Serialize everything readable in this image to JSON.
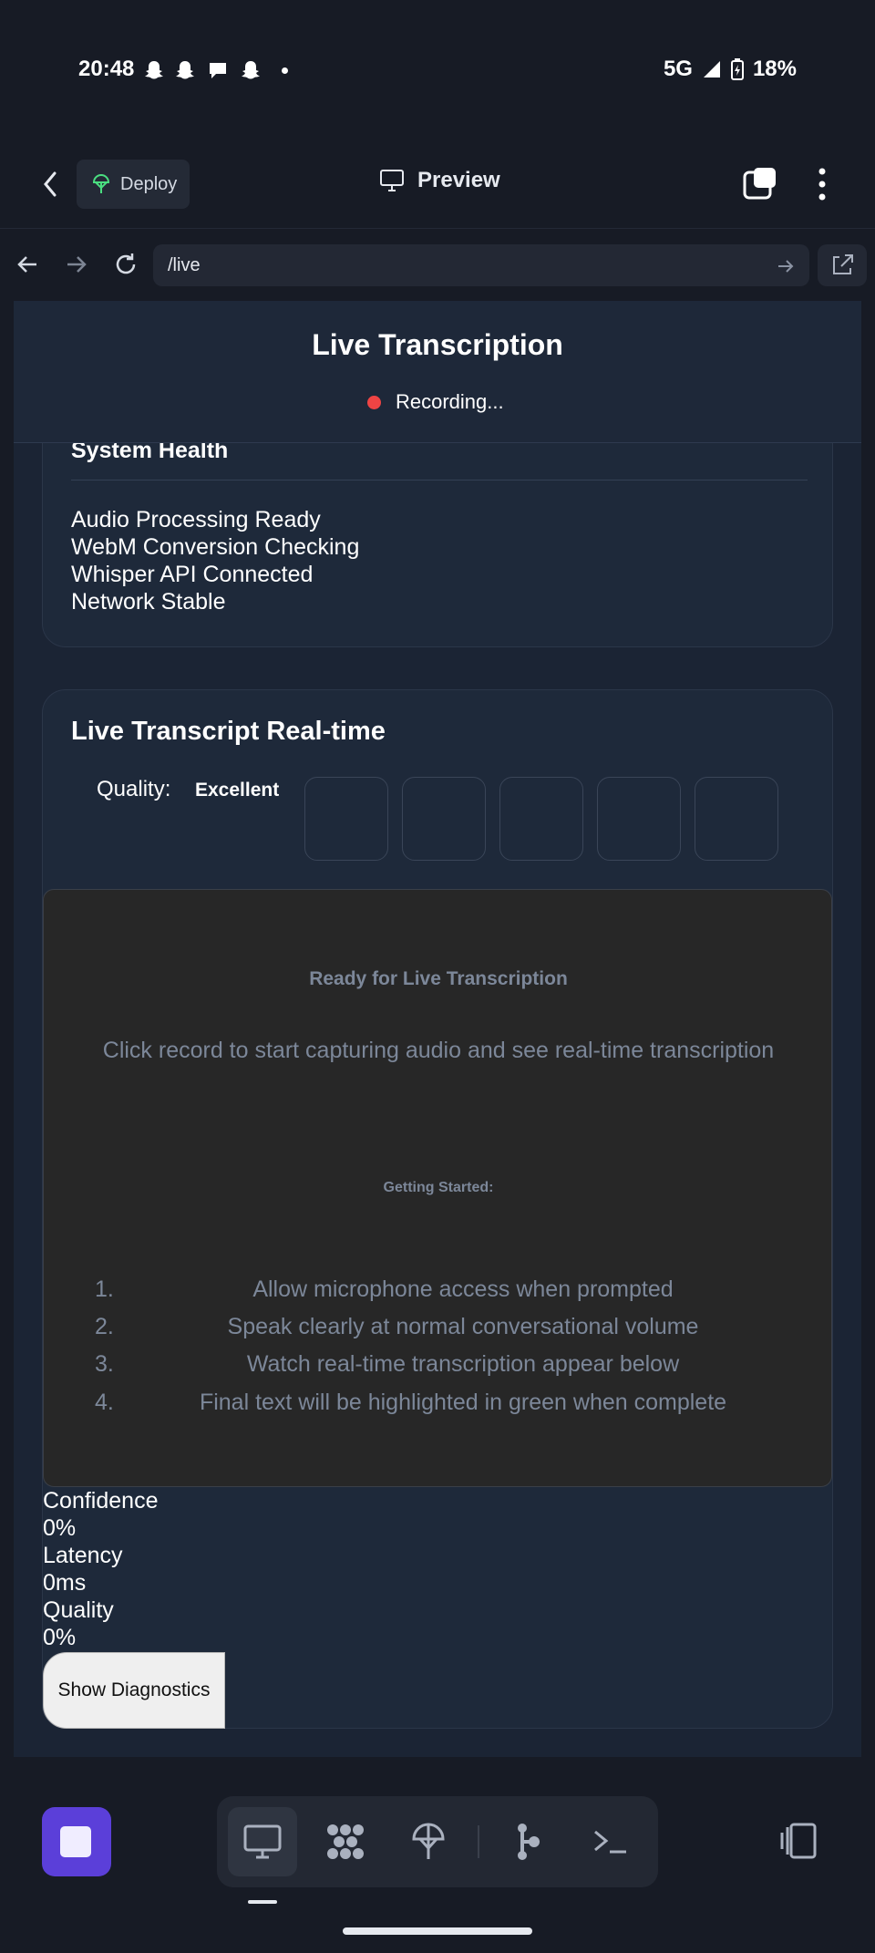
{
  "status_bar": {
    "time": "20:48",
    "network": "5G",
    "battery": "18%",
    "notification_icons": [
      "snapchat-icon",
      "snapchat-icon",
      "chat-bubble-icon",
      "snapchat-icon",
      "dot-icon"
    ]
  },
  "app_header": {
    "deploy_label": "Deploy",
    "preview_label": "Preview"
  },
  "browser": {
    "url": "/live"
  },
  "page": {
    "title": "Live Transcription",
    "recording_status": "Recording..."
  },
  "system_health": {
    "title": "System Health",
    "items": [
      "Audio Processing Ready",
      "WebM Conversion Checking",
      "Whisper API Connected",
      "Network Stable"
    ]
  },
  "transcript": {
    "title": "Live Transcript Real-time",
    "quality_label": "Quality:",
    "quality_value": "Excellent",
    "ready_title": "Ready for Live Transcription",
    "ready_description": "Click record to start capturing audio and see real-time transcription",
    "getting_started_title": "Getting Started:",
    "steps": [
      {
        "num": "1.",
        "text": "Allow microphone access when prompted"
      },
      {
        "num": "2.",
        "text": "Speak clearly at normal conversational volume"
      },
      {
        "num": "3.",
        "text": "Watch real-time transcription appear below"
      },
      {
        "num": "4.",
        "text": "Final text will be highlighted in green when complete"
      }
    ]
  },
  "metrics": {
    "confidence_label": "Confidence",
    "confidence_value": "0%",
    "latency_label": "Latency",
    "latency_value": "0ms",
    "quality_label": "Quality",
    "quality_value": "0%",
    "diagnostics_button": "Show Diagnostics"
  },
  "bottom_nav": {
    "tools": [
      "desktop-icon",
      "apps-grid-icon",
      "deploy-icon",
      "source-control-icon",
      "terminal-icon"
    ]
  },
  "colors": {
    "accent": "#5b3fd9",
    "recording": "#ef4444",
    "background": "#171b25"
  }
}
